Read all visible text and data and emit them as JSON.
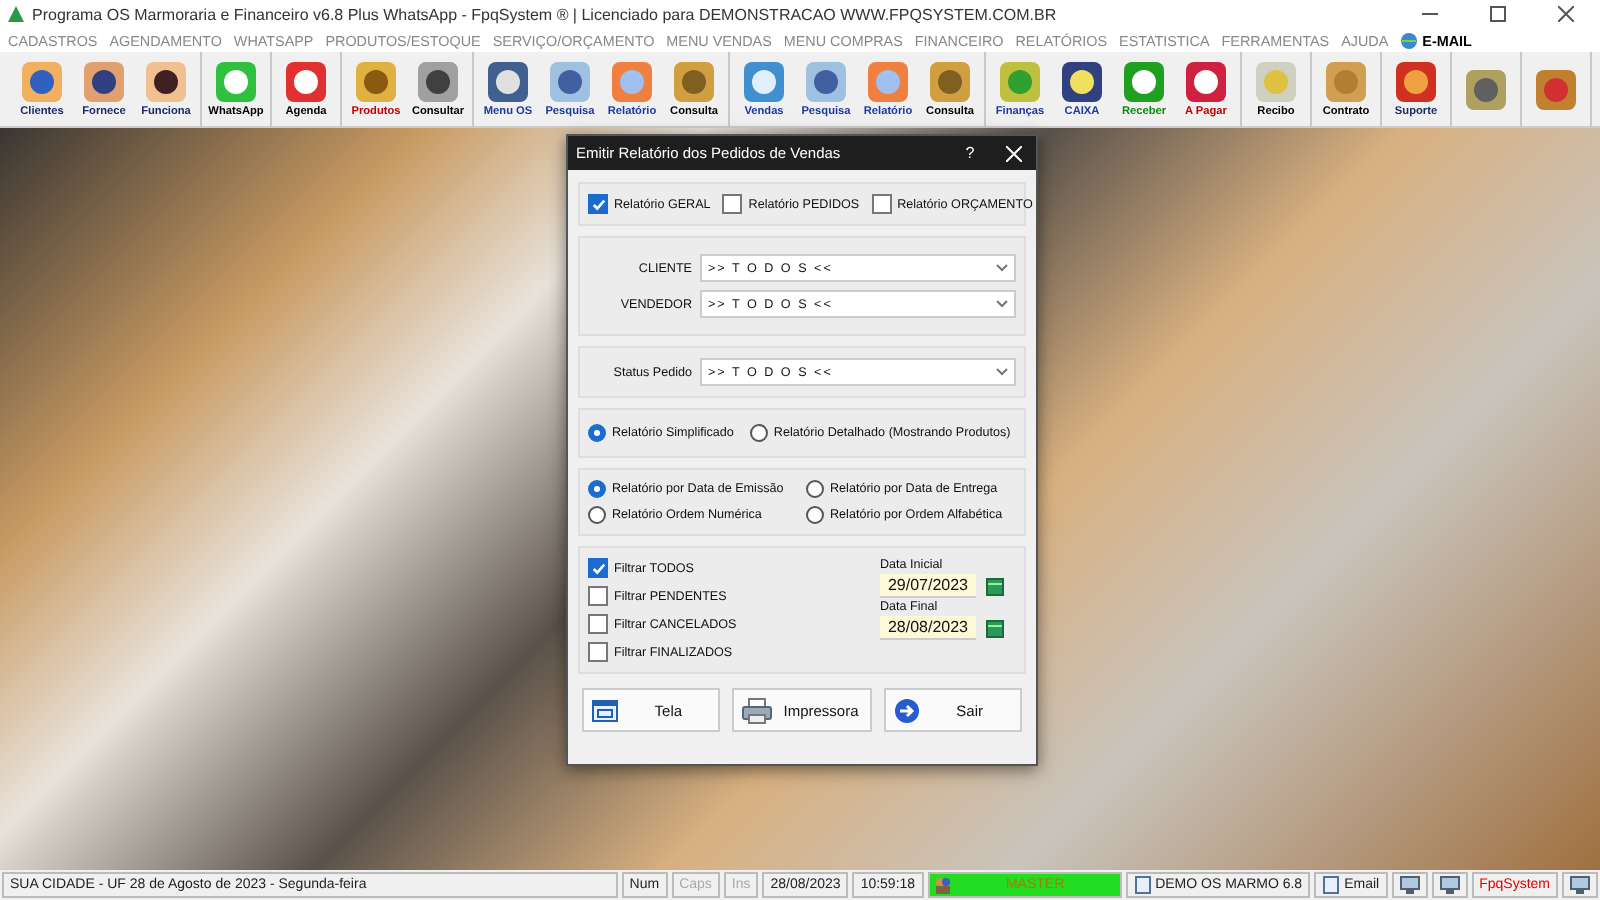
{
  "window": {
    "title": "Programa OS Marmoraria e Financeiro v6.8 Plus WhatsApp - FpqSystem ® | Licenciado para  DEMONSTRACAO WWW.FPQSYSTEM.COM.BR"
  },
  "menu": [
    {
      "label": "CADASTROS",
      "kind": "text"
    },
    {
      "label": "AGENDAMENTO",
      "kind": "text"
    },
    {
      "label": "WHATSAPP",
      "kind": "text"
    },
    {
      "label": "PRODUTOS/ESTOQUE",
      "kind": "text"
    },
    {
      "label": "SERVIÇO/ORÇAMENTO",
      "kind": "text"
    },
    {
      "label": "MENU VENDAS",
      "kind": "text"
    },
    {
      "label": "MENU COMPRAS",
      "kind": "text"
    },
    {
      "label": "FINANCEIRO",
      "kind": "text"
    },
    {
      "label": "RELATÓRIOS",
      "kind": "text"
    },
    {
      "label": "ESTATISTICA",
      "kind": "text"
    },
    {
      "label": "FERRAMENTAS",
      "kind": "text"
    },
    {
      "label": "AJUDA",
      "kind": "text"
    },
    {
      "label": "E-MAIL",
      "kind": "icon_text"
    }
  ],
  "toolbar": {
    "groups": [
      {
        "items": [
          {
            "kind": "labeled",
            "label": "Clientes",
            "color": "#1a2a6a"
          },
          {
            "kind": "labeled",
            "label": "Fornece",
            "color": "#1a2a6a"
          },
          {
            "kind": "labeled",
            "label": "Funciona",
            "color": "#1a2a6a"
          }
        ]
      },
      {
        "items": [
          {
            "kind": "labeled",
            "label": "WhatsApp",
            "color": "#000000"
          }
        ]
      },
      {
        "items": [
          {
            "kind": "labeled",
            "label": "Agenda",
            "color": "#000000"
          }
        ]
      },
      {
        "items": [
          {
            "kind": "labeled",
            "label": "Produtos",
            "color": "#c00000"
          },
          {
            "kind": "labeled",
            "label": "Consultar",
            "color": "#000000"
          }
        ]
      },
      {
        "items": [
          {
            "kind": "labeled",
            "label": "Menu OS",
            "color": "#1a3aa0"
          },
          {
            "kind": "labeled",
            "label": "Pesquisa",
            "color": "#1a3aa0"
          },
          {
            "kind": "labeled",
            "label": "Relatório",
            "color": "#1a3aa0"
          },
          {
            "kind": "labeled",
            "label": "Consulta",
            "color": "#000000"
          }
        ]
      },
      {
        "items": [
          {
            "kind": "labeled",
            "label": "Vendas",
            "color": "#1a3aa0"
          },
          {
            "kind": "labeled",
            "label": "Pesquisa",
            "color": "#1a3aa0"
          },
          {
            "kind": "labeled",
            "label": "Relatório",
            "color": "#1a3aa0"
          },
          {
            "kind": "labeled",
            "label": "Consulta",
            "color": "#000000"
          }
        ]
      },
      {
        "items": [
          {
            "kind": "labeled",
            "label": "Finanças",
            "color": "#1a3aa0"
          },
          {
            "kind": "labeled",
            "label": "CAIXA",
            "color": "#1a3aa0"
          },
          {
            "kind": "labeled",
            "label": "Receber",
            "color": "#0a8a0a"
          },
          {
            "kind": "labeled",
            "label": "A Pagar",
            "color": "#c00000"
          }
        ]
      },
      {
        "items": [
          {
            "kind": "labeled",
            "label": "Recibo",
            "color": "#000000"
          }
        ]
      },
      {
        "items": [
          {
            "kind": "labeled",
            "label": "Contrato",
            "color": "#000000"
          }
        ]
      },
      {
        "items": [
          {
            "kind": "labeled",
            "label": "Suporte",
            "color": "#1a2a6a"
          }
        ]
      },
      {
        "items": [
          {
            "kind": "icon_only"
          }
        ]
      },
      {
        "items": [
          {
            "kind": "icon_only"
          }
        ]
      }
    ]
  },
  "dialog": {
    "title": "Emitir Relatório dos Pedidos de Vendas",
    "help": "?",
    "report_types": [
      {
        "label": "Relatório GERAL",
        "checked": true
      },
      {
        "label": "Relatório PEDIDOS",
        "checked": false
      },
      {
        "label": "Relatório ORÇAMENTO",
        "checked": false
      }
    ],
    "selectors": [
      {
        "label": "CLIENTE",
        "value": ">> T O D O S <<"
      },
      {
        "label": "VENDEDOR",
        "value": ">> T O D O S <<"
      }
    ],
    "status": {
      "label": "Status Pedido",
      "value": ">> T O D O S <<"
    },
    "detail": [
      {
        "label": "Relatório Simplificado",
        "selected": true
      },
      {
        "label": "Relatório Detalhado (Mostrando Produtos)",
        "selected": false
      }
    ],
    "order": [
      {
        "label": "Relatório por Data de Emissão",
        "selected": true
      },
      {
        "label": "Relatório por Data de Entrega",
        "selected": false
      },
      {
        "label": "Relatório Ordem Numérica",
        "selected": false
      },
      {
        "label": "Relatório por Ordem Alfabética",
        "selected": false
      }
    ],
    "status_filters": [
      {
        "label": "Filtrar TODOS",
        "checked": true
      },
      {
        "label": "Filtrar PENDENTES",
        "checked": false
      },
      {
        "label": "Filtrar CANCELADOS",
        "checked": false
      },
      {
        "label": "Filtrar FINALIZADOS",
        "checked": false
      }
    ],
    "dates": [
      {
        "label": "Data Inicial",
        "value": "29/07/2023"
      },
      {
        "label": "Data Final",
        "value": "28/08/2023"
      }
    ],
    "buttons": [
      {
        "label": "Tela",
        "kind": "screen"
      },
      {
        "label": "Impressora",
        "kind": "printer"
      },
      {
        "label": "Sair",
        "kind": "exit"
      }
    ]
  },
  "status_bar": [
    {
      "kind": "text",
      "text": "SUA CIDADE - UF 28 de Agosto de 2023 - Segunda-feira",
      "disabled": false
    },
    {
      "kind": "text",
      "text": "Num",
      "disabled": false
    },
    {
      "kind": "text",
      "text": "Caps",
      "disabled": true
    },
    {
      "kind": "text",
      "text": "Ins",
      "disabled": true
    },
    {
      "kind": "text",
      "text": "28/08/2023",
      "disabled": false
    },
    {
      "kind": "text",
      "text": "10:59:18",
      "disabled": false
    },
    {
      "kind": "user",
      "text": "MASTER"
    },
    {
      "kind": "icon_text",
      "text": "DEMO OS MARMO 6.8"
    },
    {
      "kind": "icon_text",
      "text": "Email"
    },
    {
      "kind": "icon"
    },
    {
      "kind": "icon"
    },
    {
      "kind": "text",
      "text": "FpqSystem",
      "disabled": false,
      "color": "#e00000"
    },
    {
      "kind": "icon"
    }
  ]
}
